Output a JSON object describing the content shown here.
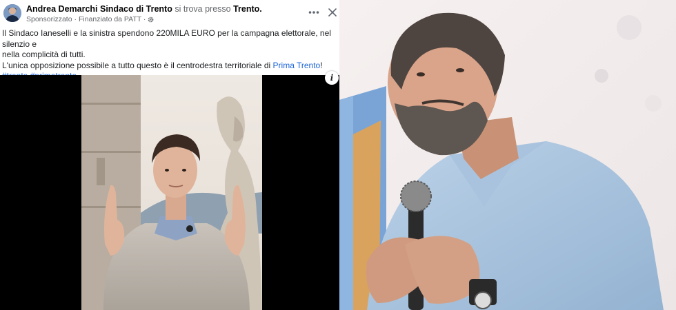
{
  "post": {
    "author": "Andrea Demarchi Sindaco di Trento",
    "location_prefix": "si trova presso",
    "location": "Trento.",
    "sponsored": "Sponsorizzato",
    "funded_by": "· Finanziato da PATT ·",
    "line1": "Il Sindaco Ianeselli e la sinistra spendono 220MILA EURO per la campagna elettorale, nel silenzio e",
    "line2": "nella complicità di tutti.",
    "line3_prefix": "L'unica opposizione possibile a tutto questo è il centrodestra territoriale di",
    "line3_link": "Prima Trento",
    "line3_suffix": "!",
    "hashtag1": "#trento",
    "hashtag2": "#primatrento",
    "info_label": "i"
  },
  "icons": {
    "more": "more-horizontal-icon",
    "close": "close-icon",
    "settings": "gear-icon",
    "info": "info-icon"
  },
  "colors": {
    "link": "#1a63d8",
    "meta": "#65676b",
    "video_background": "#000000"
  }
}
